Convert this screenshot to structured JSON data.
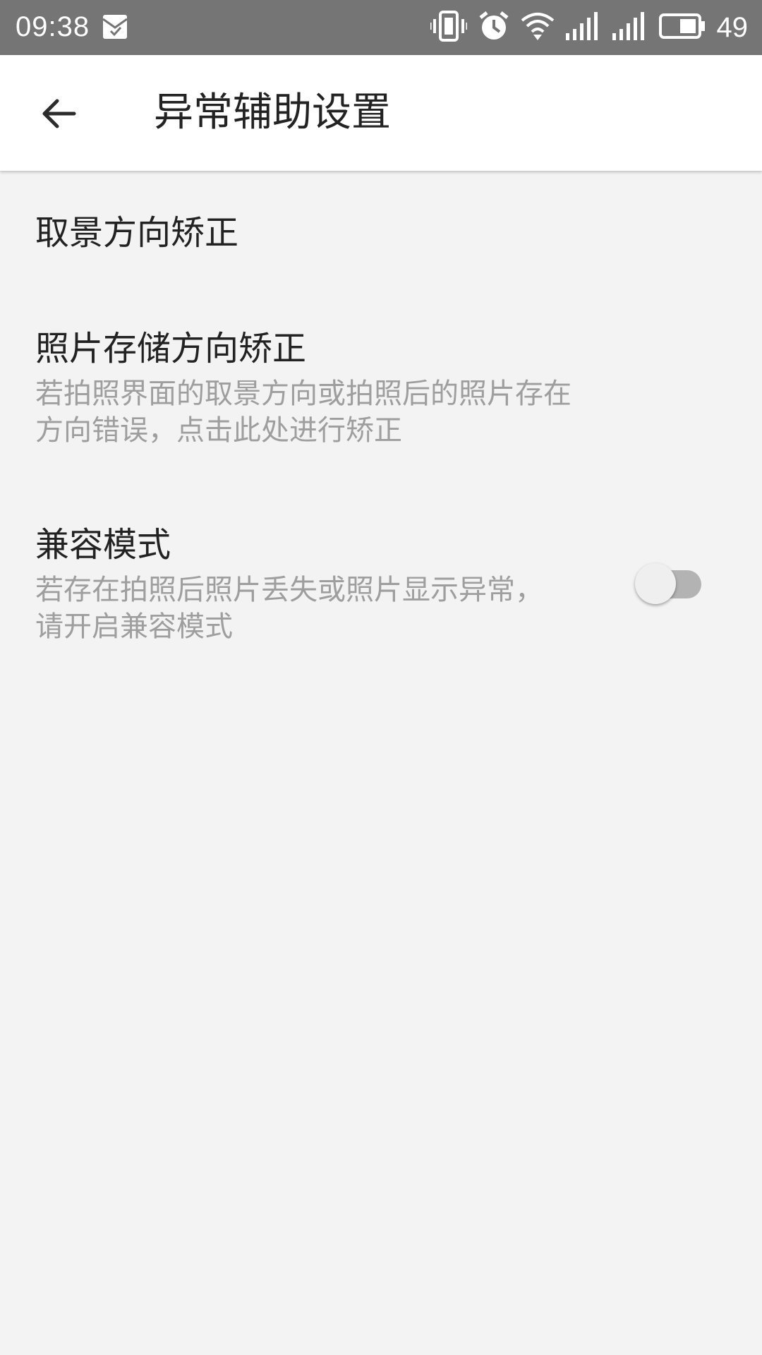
{
  "status_bar": {
    "time": "09:38",
    "battery_percent": "49",
    "icons": [
      "notification-icon",
      "vibrate-icon",
      "alarm-icon",
      "wifi-icon",
      "signal-icon",
      "signal-icon",
      "battery-icon"
    ],
    "background_color": "#757575"
  },
  "header": {
    "back_icon": "arrow-left-icon",
    "title": "异常辅助设置"
  },
  "settings": [
    {
      "title": "取景方向矫正",
      "description": ""
    },
    {
      "title": "照片存储方向矫正",
      "description": "若拍照界面的取景方向或拍照后的照片存在方向错误，点击此处进行矫正"
    },
    {
      "title": "兼容模式",
      "description": "若存在拍照后照片丢失或照片显示异常，请开启兼容模式",
      "toggle_on": false
    }
  ],
  "colors": {
    "page_background": "#f3f3f3",
    "title_text": "#222222",
    "description_text": "#9e9e9e",
    "toggle_track_off": "#b3b3b3"
  }
}
